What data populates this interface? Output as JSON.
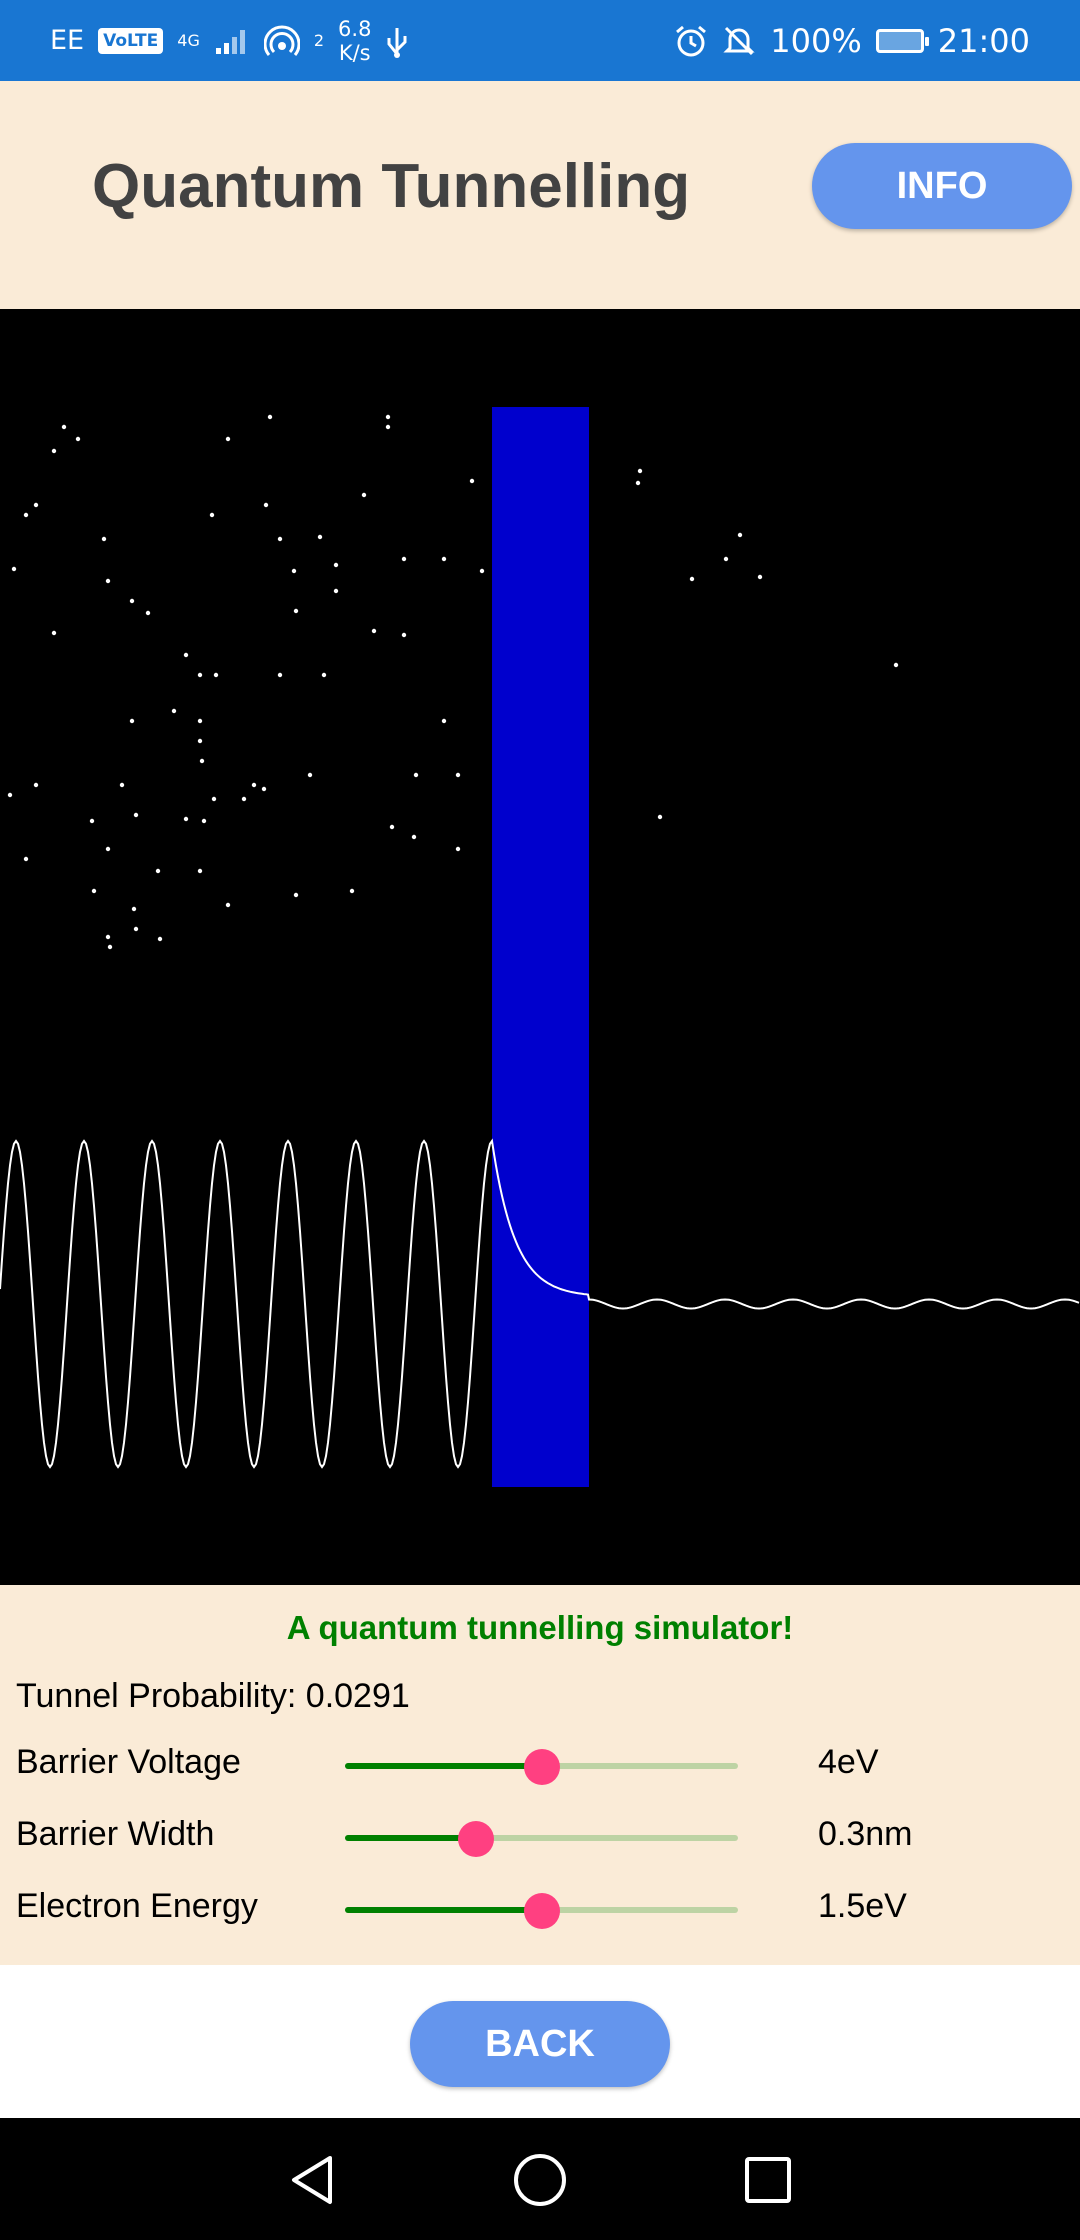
{
  "status_bar": {
    "carrier": "EE",
    "volte": "VoLTE",
    "network": "4G",
    "hotspot_count": "2",
    "speed_value": "6.8",
    "speed_unit": "K/s",
    "battery_percent": "100%",
    "time": "21:00",
    "icons": [
      "signal-icon",
      "hotspot-icon",
      "usb-icon",
      "alarm-icon",
      "mute-icon",
      "battery-charging-icon"
    ]
  },
  "header": {
    "title": "Quantum Tunnelling",
    "info_label": "INFO"
  },
  "simulation": {
    "barrier_color": "#0000cd",
    "background_color": "#000000",
    "wave_color": "#ffffff"
  },
  "controls": {
    "tagline": "A quantum tunnelling simulator!",
    "probability_text": "Tunnel Probability: 0.0291",
    "sliders": [
      {
        "label": "Barrier Voltage",
        "value": "4eV",
        "fraction": 0.5
      },
      {
        "label": "Barrier Width",
        "value": "0.3nm",
        "fraction": 0.333
      },
      {
        "label": "Electron Energy",
        "value": "1.5eV",
        "fraction": 0.5
      }
    ],
    "accent_color": "#008000",
    "thumb_color": "#ff4081"
  },
  "footer": {
    "back_label": "BACK"
  },
  "nav_bar": {
    "icons": [
      "back-triangle-icon",
      "home-circle-icon",
      "recents-square-icon"
    ]
  }
}
